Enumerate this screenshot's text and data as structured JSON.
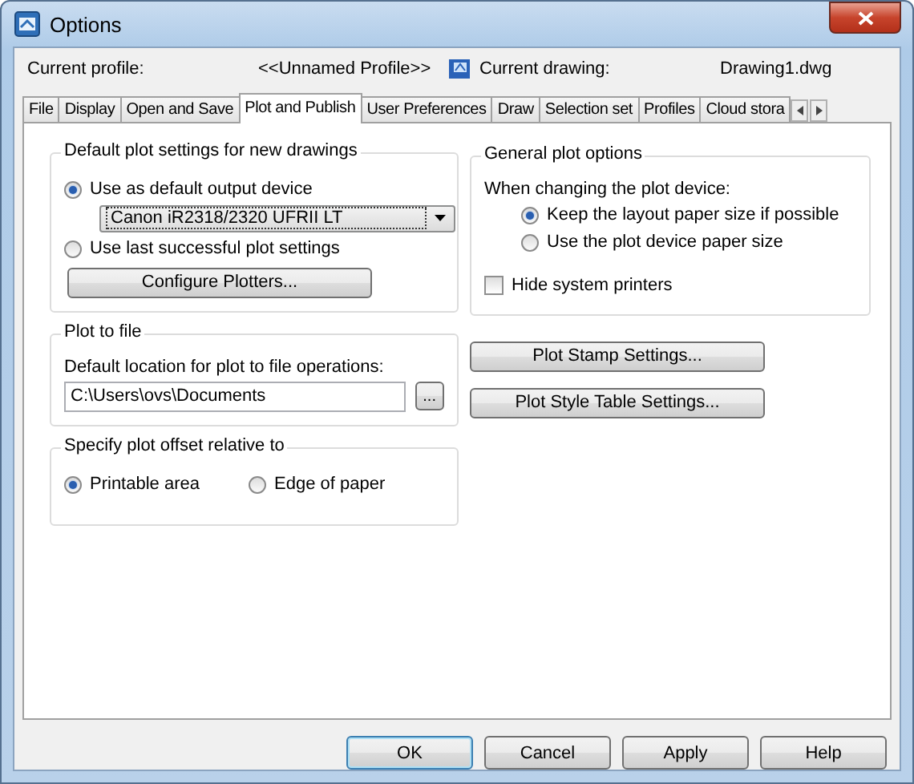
{
  "window": {
    "title": "Options"
  },
  "profile": {
    "label": "Current profile:",
    "value": "<<Unnamed Profile>>"
  },
  "drawing": {
    "label": "Current drawing:",
    "value": "Drawing1.dwg"
  },
  "tabs": [
    {
      "label": "File",
      "selected": false
    },
    {
      "label": "Display",
      "selected": false
    },
    {
      "label": "Open and Save",
      "selected": false
    },
    {
      "label": "Plot and Publish",
      "selected": true
    },
    {
      "label": "User Preferences",
      "selected": false
    },
    {
      "label": "Draw",
      "selected": false
    },
    {
      "label": "Selection set",
      "selected": false
    },
    {
      "label": "Profiles",
      "selected": false
    },
    {
      "label": "Cloud stora",
      "selected": false
    }
  ],
  "default_plot": {
    "title": "Default plot settings for new drawings",
    "options": [
      {
        "label": "Use as default output device",
        "selected": true
      },
      {
        "label": "Use last successful plot settings",
        "selected": false
      }
    ],
    "device": "Canon iR2318/2320 UFRII LT",
    "button": "Configure Plotters..."
  },
  "plot_to_file": {
    "title": "Plot to file",
    "label": "Default location for plot to file operations:",
    "value": "C:\\Users\\ovs\\Documents",
    "browse": "..."
  },
  "offset": {
    "title": "Specify plot offset relative to",
    "options": [
      {
        "label": "Printable area",
        "selected": true
      },
      {
        "label": "Edge of paper",
        "selected": false
      }
    ]
  },
  "general": {
    "title": "General plot options",
    "label": "When changing the plot device:",
    "options": [
      {
        "label": "Keep the layout paper size if possible",
        "selected": true
      },
      {
        "label": "Use the plot device paper size",
        "selected": false
      }
    ],
    "hide_printers": {
      "label": "Hide system printers",
      "checked": false
    }
  },
  "side_buttons": [
    "Plot Stamp Settings...",
    "Plot Style Table Settings..."
  ],
  "buttons": [
    {
      "label": "OK",
      "default": true
    },
    {
      "label": "Cancel",
      "default": false
    },
    {
      "label": "Apply",
      "default": false
    },
    {
      "label": "Help",
      "default": false
    }
  ]
}
